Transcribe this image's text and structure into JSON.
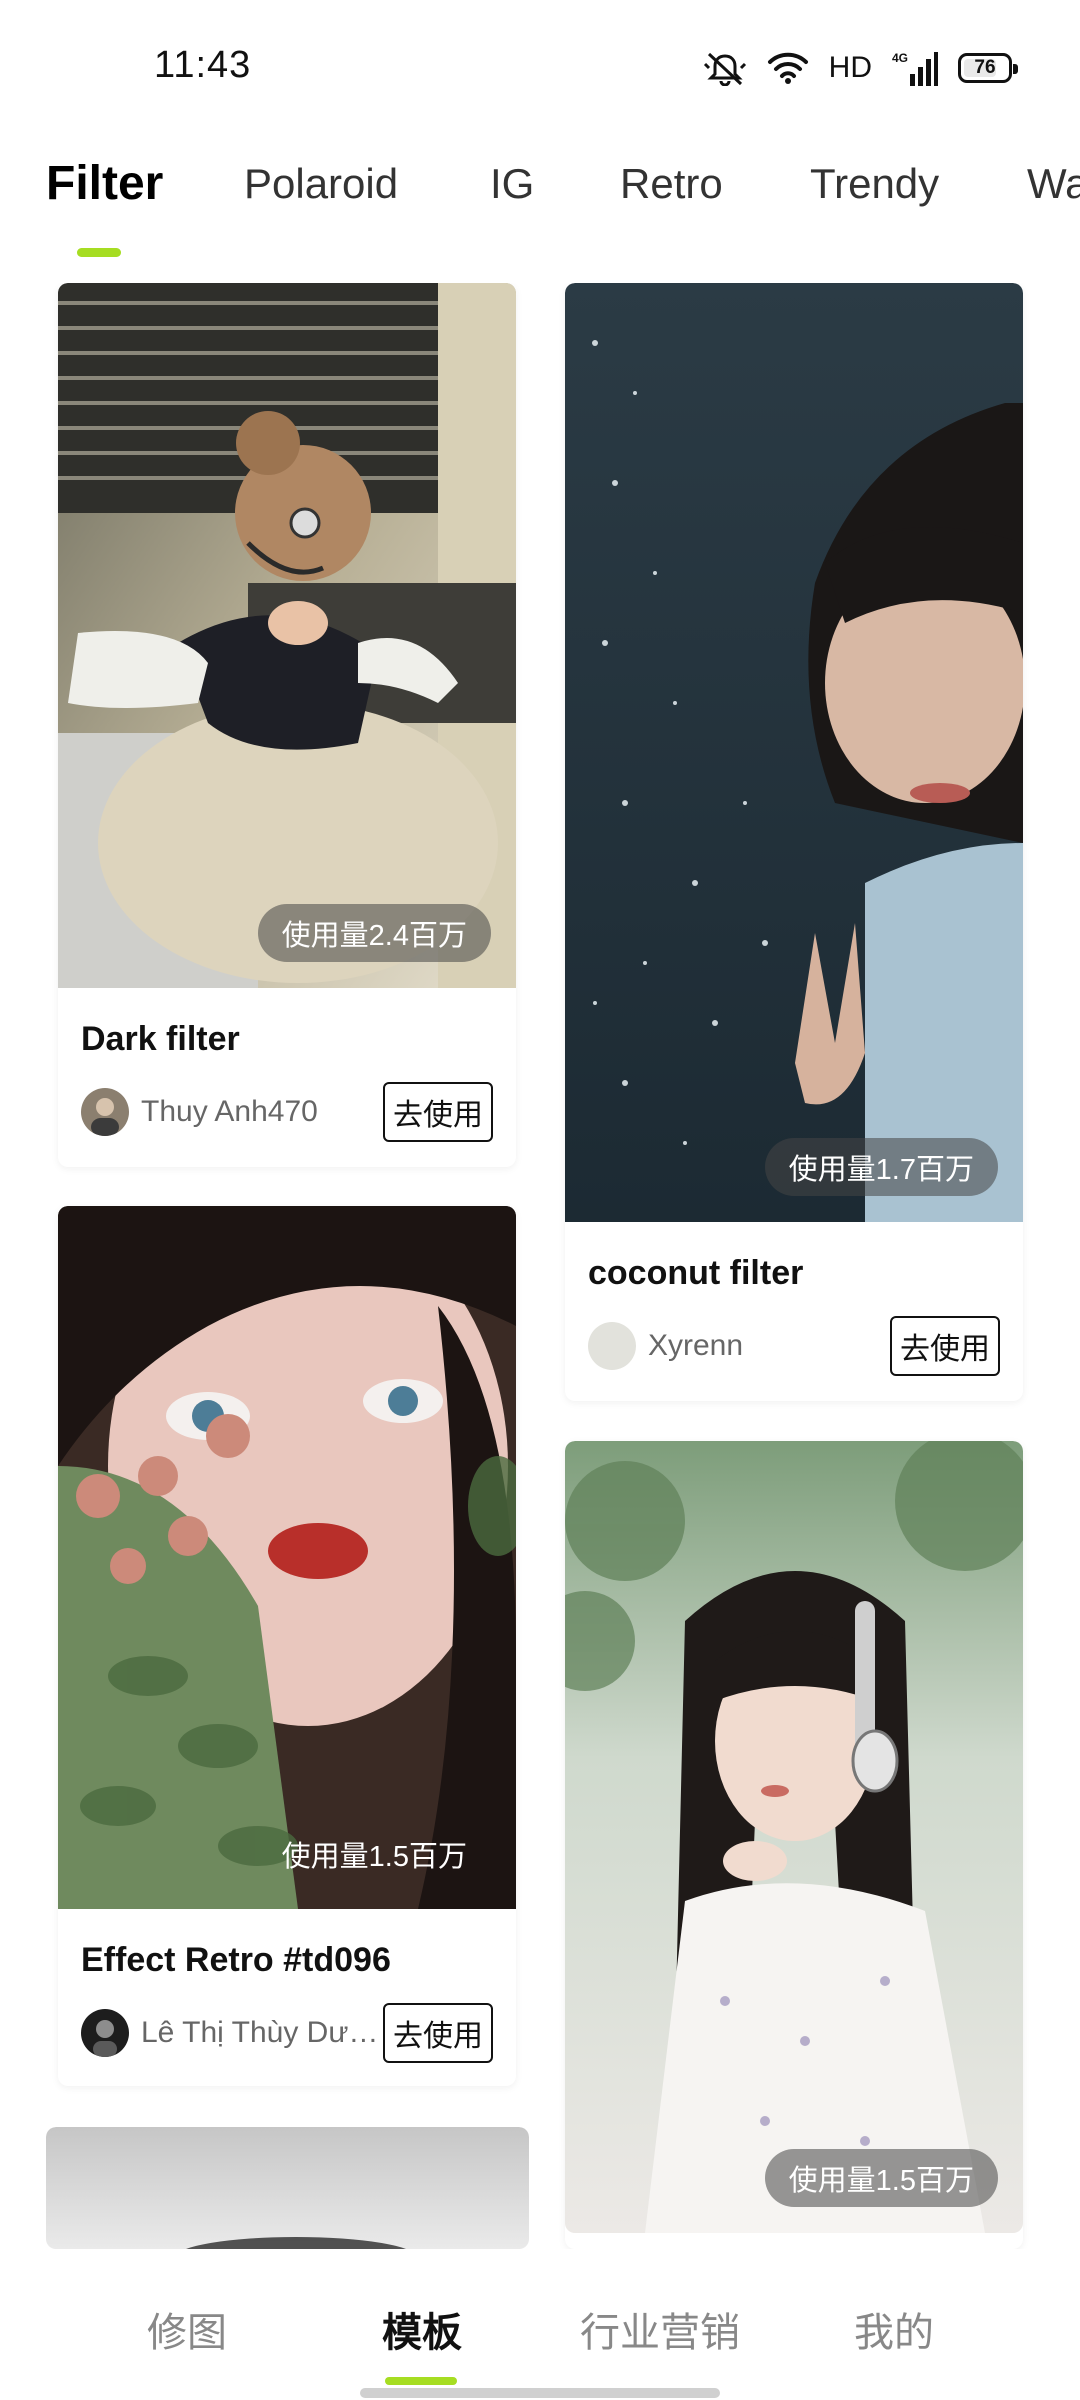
{
  "status_bar": {
    "time": "11:43",
    "network_label": "HD",
    "network_type": "4G",
    "battery_level": "76",
    "battery_fraction": 0.76,
    "icons": [
      "mute-icon",
      "wifi-icon",
      "signal-icon",
      "battery-icon"
    ]
  },
  "tabs": {
    "items": [
      {
        "label": "Filter",
        "active": true
      },
      {
        "label": "Polaroid",
        "active": false
      },
      {
        "label": "IG",
        "active": false
      },
      {
        "label": "Retro",
        "active": false
      },
      {
        "label": "Trendy",
        "active": false
      },
      {
        "label": "Wa",
        "active": false
      }
    ],
    "accent_color": "#a6dd22"
  },
  "feed": {
    "cards": [
      {
        "title": "Dark filter",
        "usage": "使用量2.4百万",
        "author": "Thuy Anh470",
        "button": "去使用",
        "image": "girl-with-headphones-photo"
      },
      {
        "title": "coconut filter",
        "usage": "使用量1.7百万",
        "author": "Xyrenn",
        "button": "去使用",
        "image": "girl-by-water-photo"
      },
      {
        "title": "Effect Retro  #td096",
        "usage": "使用量1.5百万",
        "author": "Lê Thị Thùy Dươ...",
        "button": "去使用",
        "image": "girl-with-roses-photo"
      },
      {
        "usage": "使用量1.5百万",
        "image": "girl-with-headphones-garden-photo"
      },
      {
        "image": "gray-gradient-photo"
      }
    ]
  },
  "bottom_nav": {
    "items": [
      {
        "label": "修图",
        "active": false
      },
      {
        "label": "模板",
        "active": true
      },
      {
        "label": "行业营销",
        "active": false
      },
      {
        "label": "我的",
        "active": false
      }
    ]
  }
}
